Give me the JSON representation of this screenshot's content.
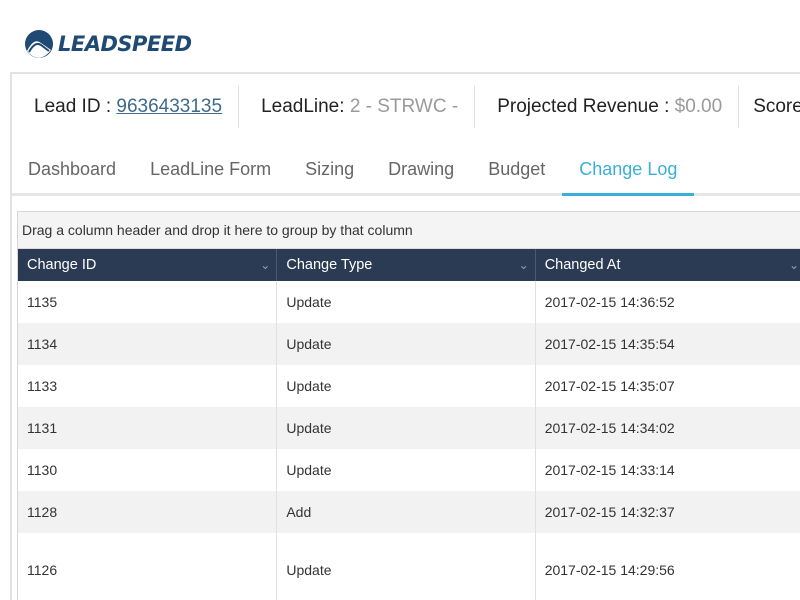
{
  "logo": {
    "text": "LEADSPEED"
  },
  "info_bar": {
    "lead_id_label": "Lead ID : ",
    "lead_id_value": "9636433135",
    "leadline_label": "LeadLine: ",
    "leadline_value": "2 - STRWC -",
    "revenue_label": "Projected Revenue : ",
    "revenue_value": "$0.00",
    "score_label": "Score"
  },
  "tabs": [
    {
      "label": "Dashboard"
    },
    {
      "label": "LeadLine Form"
    },
    {
      "label": "Sizing"
    },
    {
      "label": "Drawing"
    },
    {
      "label": "Budget"
    },
    {
      "label": "Change Log",
      "active": true
    }
  ],
  "grid": {
    "group_hint": "Drag a column header and drop it here to group by that column",
    "columns": [
      "Change ID",
      "Change Type",
      "Changed At"
    ],
    "rows": [
      [
        "1135",
        "Update",
        "2017-02-15 14:36:52"
      ],
      [
        "1134",
        "Update",
        "2017-02-15 14:35:54"
      ],
      [
        "1133",
        "Update",
        "2017-02-15 14:35:07"
      ],
      [
        "1131",
        "Update",
        "2017-02-15 14:34:02"
      ],
      [
        "1130",
        "Update",
        "2017-02-15 14:33:14"
      ],
      [
        "1128",
        "Add",
        "2017-02-15 14:32:37"
      ],
      [
        "1126",
        "Update",
        "2017-02-15 14:29:56"
      ]
    ]
  },
  "colors": {
    "brand": "#1e4a73",
    "accent": "#3aaed8",
    "header_bg": "#2b3b53"
  }
}
